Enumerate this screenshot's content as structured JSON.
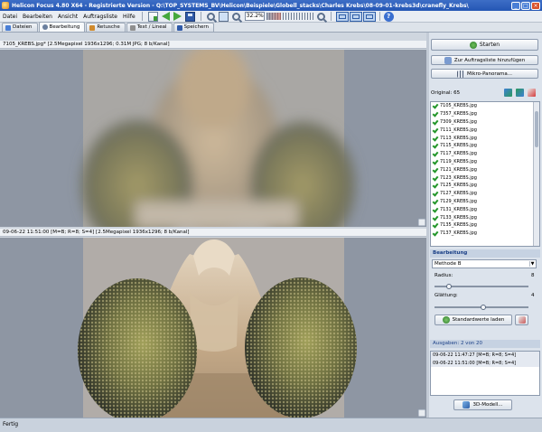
{
  "window": {
    "title": "Helicon Focus 4.80 X64 - Registrierte Version - Q:\\TOP_SYSTEMS_BV\\Helicon\\Beispiele\\Globell_stacks\\Charles Krebs\\08-09-01-krebs3d\\cranefly_Krebs\\",
    "minimize": "_",
    "maximize": "□",
    "close": "×"
  },
  "menu": [
    "Datei",
    "Bearbeiten",
    "Ansicht",
    "Auftragsliste",
    "Hilfe"
  ],
  "toolbar": {
    "zoom_value": "32.2%",
    "zoom_fraction": 0.322,
    "help": "?"
  },
  "tabs": [
    {
      "label": "Dateien",
      "icon": "folder-icon",
      "color": "#4a7fd6"
    },
    {
      "label": "Bearbeitung",
      "icon": "gear-icon",
      "color": "#6a7f9e"
    },
    {
      "label": "Retusche",
      "icon": "brush-icon",
      "color": "#d08a2c"
    },
    {
      "label": "Text / Lineal",
      "icon": "ruler-icon",
      "color": "#8f8f8f"
    },
    {
      "label": "Speichern",
      "icon": "save-icon",
      "color": "#2f59a8"
    }
  ],
  "source_view": {
    "header": "7105_KREBS.jpg* [2.5Megapixel 1936x1296; 0.31M JPG; 8 b/Kanal]"
  },
  "result_view": {
    "header": "09-06-22 11:51:00 [M=B; R=8; S=4] [2.5Megapixel 1936x1296; 8 b/Kanal]"
  },
  "right_panel": {
    "start_button": "Starten",
    "add_queue_button": "Zur Auftragsliste hinzufügen",
    "panorama_button": "Mikro-Panorama...",
    "originals_label": "Original: 65",
    "files": [
      "7105_KREBS.jpg",
      "7357_KREBS.jpg",
      "7309_KREBS.jpg",
      "7111_KREBS.jpg",
      "7113_KREBS.jpg",
      "7115_KREBS.jpg",
      "7117_KREBS.jpg",
      "7119_KREBS.jpg",
      "7121_KREBS.jpg",
      "7123_KREBS.jpg",
      "7125_KREBS.jpg",
      "7127_KREBS.jpg",
      "7129_KREBS.jpg",
      "7131_KREBS.jpg",
      "7133_KREBS.jpg",
      "7135_KREBS.jpg",
      "7137_KREBS.jpg"
    ],
    "processing_title": "Bearbeitung",
    "method_value": "Methode B",
    "radius_label": "Radius:",
    "radius_value": "8",
    "radius_fraction": 0.15,
    "smoothing_label": "Glättung:",
    "smoothing_value": "4",
    "smoothing_fraction": 0.52,
    "defaults_button": "Standardwerte laden",
    "outputs_title": "Ausgaben: 2 von 20",
    "outputs": [
      "09-06-22 11:47:27 [M=B; R=8; S=4]",
      "09-06-22 11:51:00 [M=B; R=8; S=4]"
    ],
    "model3d_button": "3D-Modell..."
  },
  "status": {
    "text": "Fertig"
  }
}
